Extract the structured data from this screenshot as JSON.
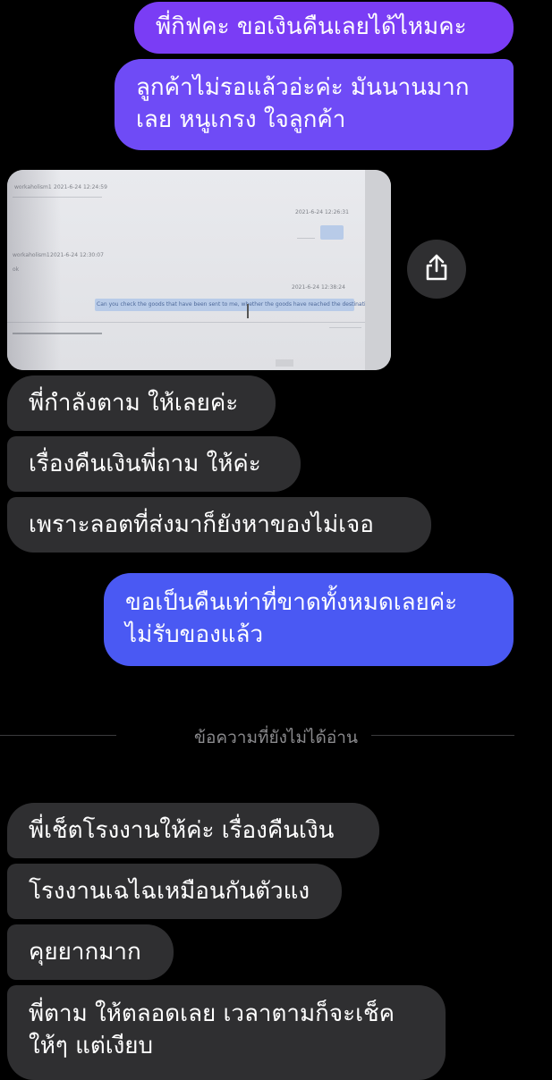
{
  "messages": {
    "m1": "พี่กิฟคะ ขอเงินคืนเลยได้ไหมคะ",
    "m2": "ลูกค้าไม่รอแล้วอ่ะค่ะ มันนานมาก\nเลย หนูเกรง ใจลูกค้า",
    "m3": "พี่กำลังตาม ให้เลยค่ะ",
    "m4": "เรื่องคืนเงินพี่ถาม ให้ค่ะ",
    "m5": "เพราะลอตที่ส่งมาก็ยังหาของไม่เจอ",
    "m6": "ขอเป็นคืนเท่าที่ขาดทั้งหมดเลยค่ะ\nไม่รับของแล้ว",
    "m7": "พี่เช็ตโรงงานให้ค่ะ เรื่องคืนเงิน",
    "m8": "โรงงานเฉไฉเหมือนกันตัวแง",
    "m9": "คุยยากมาก",
    "m10": "พี่ตาม ให้ตลอดเลย เวลาตามก็จะเช็ค\nให้ๆ แต่เงียบ"
  },
  "divider": {
    "label": "ข้อความที่ยังไม่ได้อ่าน"
  },
  "attachment": {
    "sender1": "workaholism1",
    "time1": "2021-6-24 12:24:59",
    "time2": "2021-6-24 12:26:31",
    "sender2": "workaholism1",
    "time3": "2021-6-24 12:30:07",
    "time4": "2021-6-24 12:38:24",
    "message_en": "Can you check the goods that have been sent to me, whether the goods have reached the destination?",
    "ok": "ok"
  },
  "icons": {
    "share": "share-icon"
  },
  "colors": {
    "outgoing_purple": "#7a3df5",
    "outgoing_blue": "#4a59f3",
    "incoming_gray": "#2f2f31",
    "background": "#000000"
  }
}
